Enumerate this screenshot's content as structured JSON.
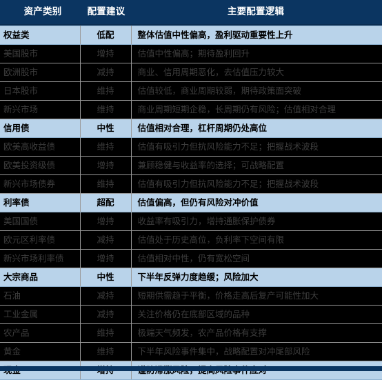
{
  "header": {
    "col_asset": "资产类别",
    "col_advice": "配置建议",
    "col_logic": "主要配置逻辑"
  },
  "colors": {
    "header_band": "#0b3561",
    "group_row_bg": "#b9d3ea",
    "normal_row_bg": "#000000",
    "normal_row_text": "#3d3d3d",
    "group_row_text": "#000000",
    "grid_line": "#9a9a9a"
  },
  "rows": [
    {
      "type": "group",
      "asset": "权益类",
      "advice": "低配",
      "logic": "整体估值中性偏高，盈利驱动重要性上升"
    },
    {
      "type": "normal",
      "asset": "美国股市",
      "advice": "增持",
      "logic": "估值中性偏高；期待盈利回升"
    },
    {
      "type": "normal",
      "asset": "欧洲股市",
      "advice": "减持",
      "logic": "商业、信用周期恶化，去估值压力较大"
    },
    {
      "type": "normal",
      "asset": "日本股市",
      "advice": "维持",
      "logic": "估值较低，商业周期较弱，期待政策面突破"
    },
    {
      "type": "normal",
      "asset": "新兴市场",
      "advice": "维持",
      "logic": "商业周期短期企稳，长周期仍有风险；估值相对合理"
    },
    {
      "type": "group",
      "asset": "信用债",
      "advice": "中性",
      "logic": "估值相对合理，杠杆周期仍处高位"
    },
    {
      "type": "normal",
      "asset": "欧美高收益债",
      "advice": "维持",
      "logic": "估值有吸引力但抗风险能力不足；把握战术波段"
    },
    {
      "type": "normal",
      "asset": "欧美投资级债",
      "advice": "增持",
      "logic": "兼顾稳健与收益率的选择；可战略配置"
    },
    {
      "type": "normal",
      "asset": "新兴市场债券",
      "advice": "维持",
      "logic": "估值有吸引力但抗风险能力不足；把握战术波段"
    },
    {
      "type": "group",
      "asset": "利率债",
      "advice": "超配",
      "logic": "估值偏高，但仍有风险对冲价值"
    },
    {
      "type": "normal",
      "asset": "美国国债",
      "advice": "增持",
      "logic": "收益率有吸引力，增持通胀保护债券"
    },
    {
      "type": "normal",
      "asset": "欧元区利率债",
      "advice": "减持",
      "logic": "估值处于历史高位，负利率下空间有限"
    },
    {
      "type": "normal",
      "asset": "新兴市场利率债",
      "advice": "增持",
      "logic": "估值相对中性，仍有宽松空间"
    },
    {
      "type": "group",
      "asset": "大宗商品",
      "advice": "中性",
      "logic": "下半年反弹力度趋缓；风险加大"
    },
    {
      "type": "normal",
      "asset": "石油",
      "advice": "减持",
      "logic": "短期供需趋于平衡，价格走高后复产可能性加大"
    },
    {
      "type": "normal",
      "asset": "工业金属",
      "advice": "减持",
      "logic": "关注价格仍在底部区域的品种"
    },
    {
      "type": "normal",
      "asset": "农产品",
      "advice": "维持",
      "logic": "极端天气频发，农产品价格有支撑"
    },
    {
      "type": "normal",
      "asset": "黄金",
      "advice": "维持",
      "logic": "下半年风险事件集中，战略配置对冲尾部风险"
    },
    {
      "type": "group",
      "asset": "现金",
      "advice": "增持",
      "logic": "谨防滞涨风险，提高风险事件应对"
    }
  ]
}
